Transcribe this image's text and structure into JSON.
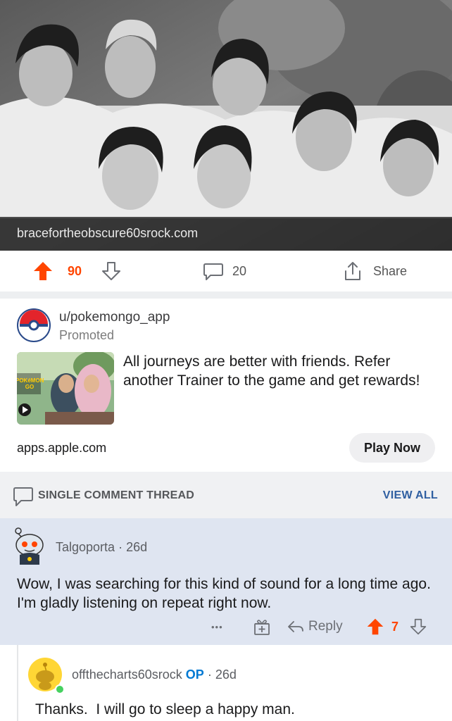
{
  "post": {
    "link_domain": "bracefortheobscure60srock.com",
    "score": "90",
    "comment_count": "20",
    "share_label": "Share"
  },
  "promoted": {
    "username": "u/pokemongo_app",
    "label": "Promoted",
    "body": "All journeys are better with friends. Refer another Trainer to the game and get rewards!",
    "domain": "apps.apple.com",
    "cta_label": "Play Now",
    "thumb_logo": "POKéMON GO"
  },
  "thread": {
    "title": "SINGLE COMMENT THREAD",
    "view_all": "VIEW ALL"
  },
  "comments": [
    {
      "author": "Talgoporta",
      "age": "26d",
      "body": "Wow, I was searching for this kind of sound for a long time ago. I'm gladly listening on repeat right now.",
      "more": "•••",
      "reply_label": "Reply",
      "score": "7"
    },
    {
      "author": "offthecharts60srock",
      "op_tag": "OP",
      "age": "26d",
      "body": "Thanks.  I will go to sleep a happy man."
    }
  ],
  "icons": {
    "upvote": "upvote-arrow-icon",
    "downvote": "downvote-arrow-icon",
    "comment": "comment-bubble-icon",
    "share": "share-icon",
    "reply": "reply-arrow-icon",
    "award": "award-gift-icon"
  },
  "colors": {
    "upvote_active": "#ff4500",
    "view_all": "#2f5fa1",
    "op_tag": "#0079d3",
    "highlight_bg": "#dfe5f1"
  }
}
